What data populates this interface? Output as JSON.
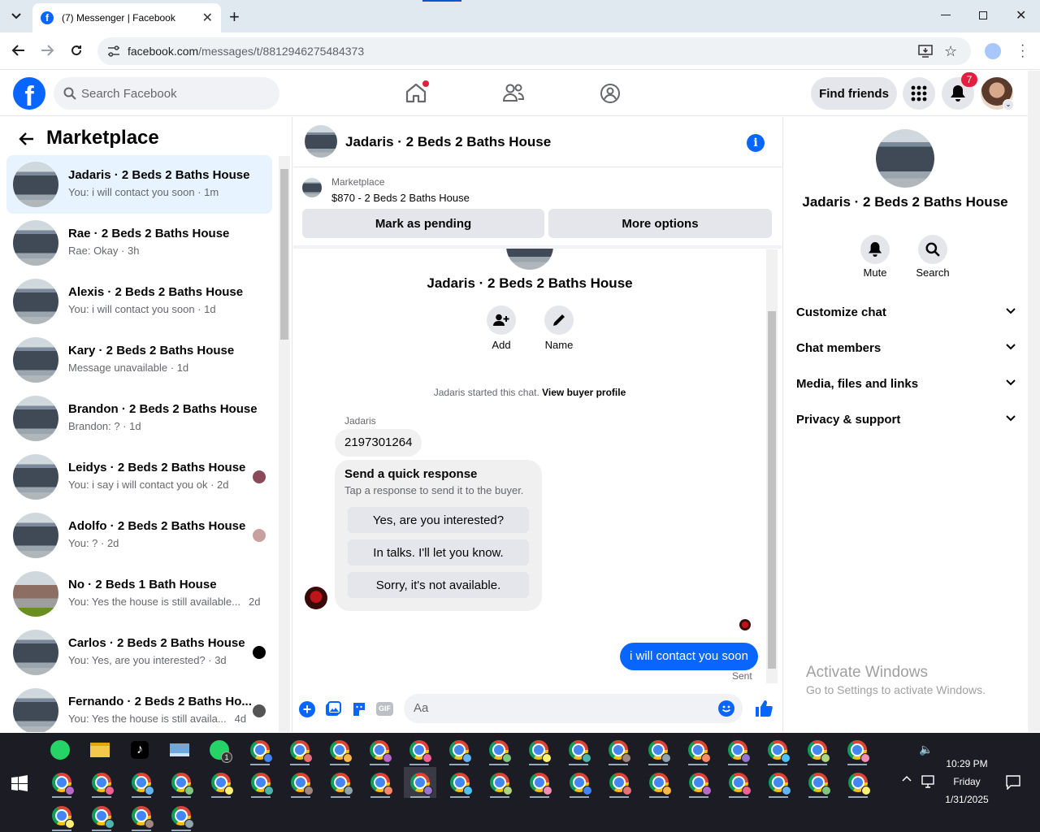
{
  "browser": {
    "tab_title": "(7) Messenger | Facebook",
    "url_domain": "facebook.com",
    "url_path": "/messages/t/8812946275484373"
  },
  "header": {
    "search_placeholder": "Search Facebook",
    "find_friends_label": "Find friends",
    "notification_count": "7"
  },
  "left": {
    "title": "Marketplace",
    "conversations": [
      {
        "name": "Jadaris · 2 Beds 2 Baths House",
        "preview": "You: i will contact you soon · 1m",
        "active": true
      },
      {
        "name": "Rae · 2 Beds 2 Baths House",
        "preview": "Rae: Okay · 3h"
      },
      {
        "name": "Alexis · 2 Beds 2 Baths House",
        "preview": "You: i will contact you soon · 1d"
      },
      {
        "name": "Kary · 2 Beds 2 Baths House",
        "preview": "Message unavailable · 1d"
      },
      {
        "name": "Brandon · 2 Beds 2 Baths House",
        "preview": "Brandon: ? · 1d"
      },
      {
        "name": "Leidys · 2 Beds 2 Baths House",
        "preview": "You: i say i will contact you ok · 2d"
      },
      {
        "name": "Adolfo · 2 Beds 2 Baths House",
        "preview": "You: ? · 2d"
      },
      {
        "name": "No · 2 Beds 1 Bath House",
        "preview": "You: Yes the house is still available...",
        "time": "2d"
      },
      {
        "name": "Carlos · 2 Beds 2 Baths House",
        "preview": "You: Yes, are you interested? · 3d"
      },
      {
        "name": "Fernando · 2 Beds 2 Baths Ho...",
        "preview": "You: Yes the house is still availa...",
        "time": "4d"
      }
    ]
  },
  "chat": {
    "title": "Jadaris · 2 Beds 2 Baths House",
    "listing_source": "Marketplace",
    "listing_text": "$870 - 2 Beds 2 Baths House",
    "mark_pending_label": "Mark as pending",
    "more_options_label": "More options",
    "profile_name": "Jadaris · 2 Beds 2 Baths House",
    "add_label": "Add",
    "name_label": "Name",
    "started_text": "Jadaris started this chat.",
    "view_buyer_label": "View buyer profile",
    "sender_name": "Jadaris",
    "incoming_message": "2197301264",
    "quick_title": "Send a quick response",
    "quick_subtitle": "Tap a response to send it to the buyer.",
    "quick_responses": [
      "Yes, are you interested?",
      "In talks. I'll let you know.",
      "Sorry, it's not available."
    ],
    "outgoing_message": "i will contact you soon",
    "sent_status": "Sent",
    "composer_placeholder": "Aa"
  },
  "right": {
    "name": "Jadaris · 2 Beds 2 Baths House",
    "mute_label": "Mute",
    "search_label": "Search",
    "sections": [
      "Customize chat",
      "Chat members",
      "Media, files and links",
      "Privacy & support"
    ]
  },
  "watermark": {
    "title": "Activate Windows",
    "subtitle": "Go to Settings to activate Windows."
  },
  "taskbar": {
    "time": "10:29 PM",
    "day": "Friday",
    "date": "1/31/2025",
    "whatsapp_badge": "1"
  },
  "colors": {
    "fb_blue": "#0866ff",
    "active_row": "#e7f3ff",
    "badge_red": "#e41e3f"
  }
}
